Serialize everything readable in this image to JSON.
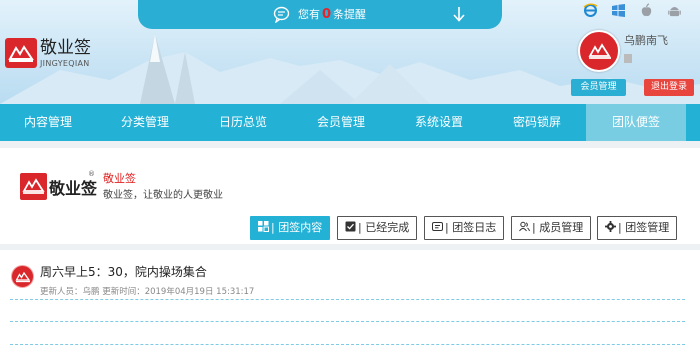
{
  "notice": {
    "prefix": "您有",
    "count": "0",
    "suffix": "条提醒"
  },
  "brand": {
    "name": "敬业签",
    "sub": "JINGYEQIAN"
  },
  "user": {
    "name": "乌鹏南飞"
  },
  "header_buttons": {
    "member": "会员管理",
    "logout": "退出登录"
  },
  "nav": {
    "items": [
      "内容管理",
      "分类管理",
      "日历总览",
      "会员管理",
      "系统设置",
      "密码锁屏",
      "团队便签"
    ],
    "active_index": 6
  },
  "card": {
    "logo_text": "敬业签",
    "registered_mark": "®",
    "title": "敬业签",
    "description": "敬业签，让敬业的人更敬业"
  },
  "tabs": [
    {
      "label": "| 团签内容",
      "icon": "grid-icon"
    },
    {
      "label": "| 已经完成",
      "icon": "check-icon"
    },
    {
      "label": "| 团签日志",
      "icon": "log-icon"
    },
    {
      "label": "| 成员管理",
      "icon": "users-icon"
    },
    {
      "label": "| 团签管理",
      "icon": "gear-icon"
    }
  ],
  "list": {
    "items": [
      {
        "title": "周六早上5：30，院内操场集合",
        "meta": "更新人员：乌鹏  更新时间：2019年04月19日 15:31:17"
      }
    ]
  },
  "colors": {
    "accent": "#23b1d6",
    "brand_red": "#d9272c",
    "logout": "#e8453f"
  }
}
